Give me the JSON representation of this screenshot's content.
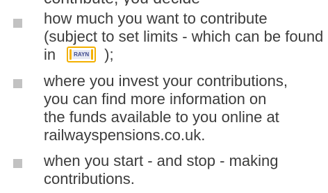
{
  "header_fragment": {
    "text": "contribute, you decide"
  },
  "bullets": [
    {
      "lines": [
        "how much you want to contribute",
        "(subject to set limits - which can be found"
      ],
      "inline_prefix": "in",
      "inline_suffix": ");",
      "badge": {
        "text": "RAYN",
        "icon": "rayn-guide-icon",
        "border_color": "#f3b000",
        "text_color": "#3e4a8e"
      }
    },
    {
      "lines": [
        "where you invest your contributions,",
        "you can find more information on",
        "the funds available to you online at",
        "railwayspensions.co.uk."
      ]
    },
    {
      "lines": [
        "when you start - and stop - making",
        "contributions."
      ]
    }
  ],
  "colors": {
    "text": "#3c3c3c",
    "bullet": "#c2c2c2",
    "badge_border": "#f3b000"
  }
}
